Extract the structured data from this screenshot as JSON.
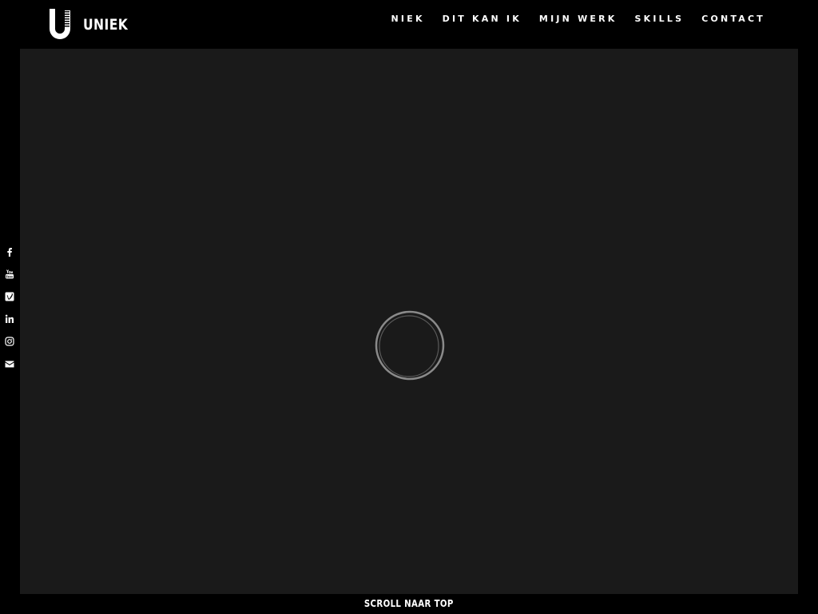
{
  "header": {
    "logo_text": "UNIEK",
    "nav": [
      {
        "label": "NIEK"
      },
      {
        "label": "DIT KAN IK"
      },
      {
        "label": "MIJN WERK"
      },
      {
        "label": "SKILLS"
      },
      {
        "label": "CONTACT"
      }
    ]
  },
  "social": [
    {
      "icon": "facebook-icon"
    },
    {
      "icon": "youtube-icon"
    },
    {
      "icon": "vimeo-icon"
    },
    {
      "icon": "linkedin-icon"
    },
    {
      "icon": "instagram-icon"
    },
    {
      "icon": "envelope-icon"
    }
  ],
  "footer": {
    "scroll_label": "SCROLL NAAR TOP"
  },
  "colors": {
    "background": "#000000",
    "stage": "#1a1a1a",
    "text": "#ffffff",
    "loader": "#8a8a8a"
  }
}
